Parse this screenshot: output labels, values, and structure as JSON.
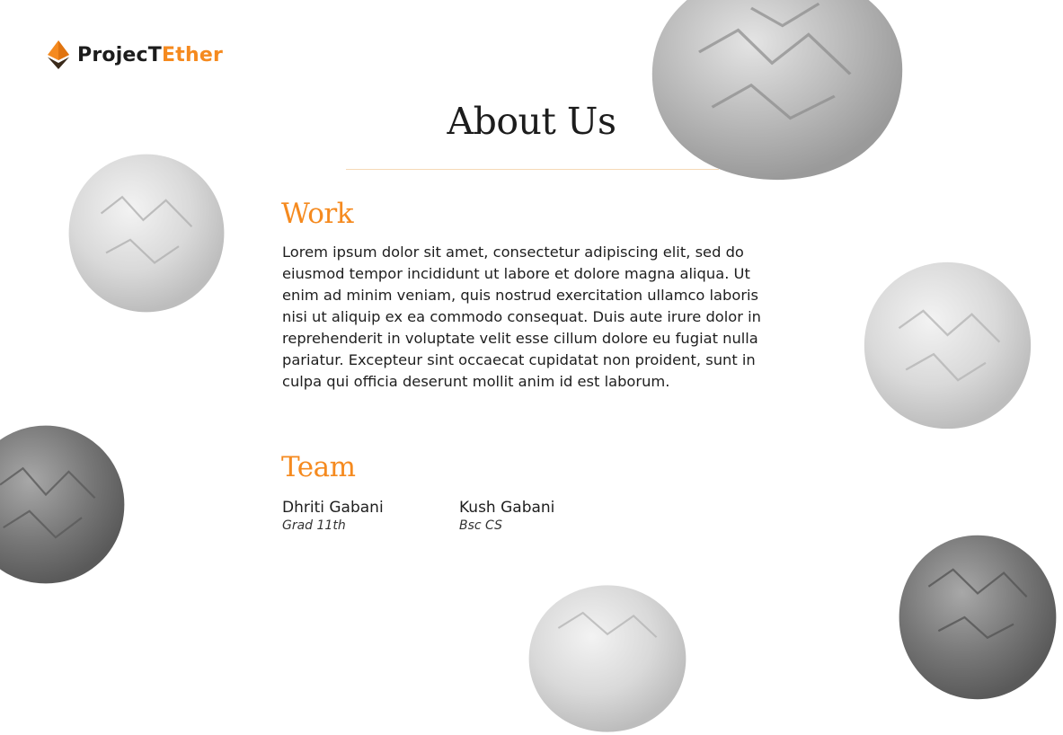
{
  "brand": {
    "part1": "Projec",
    "glyph": "T",
    "part2": "Ether",
    "accent": "#f58a1f"
  },
  "page": {
    "title": "About Us"
  },
  "work": {
    "heading": "Work",
    "text": "Lorem ipsum dolor sit amet, consectetur adipiscing elit, sed do eiusmod tempor incididunt ut labore et dolore magna aliqua. Ut enim ad minim veniam, quis nostrud exercitation ullamco laboris nisi ut aliquip ex ea commodo consequat. Duis aute irure dolor in reprehenderit in voluptate velit esse cillum dolore eu fugiat nulla pariatur. Excepteur sint occaecat cupidatat non proident, sunt in culpa qui officia deserunt mollit anim id est laborum."
  },
  "team": {
    "heading": "Team",
    "members": [
      {
        "name": "Dhriti Gabani",
        "role": "Grad 11th"
      },
      {
        "name": "Kush Gabani",
        "role": "Bsc CS"
      }
    ]
  }
}
